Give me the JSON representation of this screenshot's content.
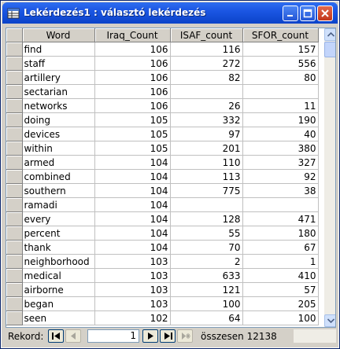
{
  "window": {
    "title": "Lekérdezés1 : választó lekérdezés"
  },
  "columns": [
    "Word",
    "Iraq_Count",
    "ISAF_count",
    "SFOR_count"
  ],
  "rows": [
    [
      "find",
      "106",
      "116",
      "157"
    ],
    [
      "staff",
      "106",
      "272",
      "556"
    ],
    [
      "artillery",
      "106",
      "82",
      "80"
    ],
    [
      "sectarian",
      "106",
      "",
      ""
    ],
    [
      "networks",
      "106",
      "26",
      "11"
    ],
    [
      "doing",
      "105",
      "332",
      "190"
    ],
    [
      "devices",
      "105",
      "97",
      "40"
    ],
    [
      "within",
      "105",
      "201",
      "380"
    ],
    [
      "armed",
      "104",
      "110",
      "327"
    ],
    [
      "combined",
      "104",
      "113",
      "92"
    ],
    [
      "southern",
      "104",
      "775",
      "38"
    ],
    [
      "ramadi",
      "104",
      "",
      ""
    ],
    [
      "every",
      "104",
      "128",
      "471"
    ],
    [
      "percent",
      "104",
      "55",
      "180"
    ],
    [
      "thank",
      "104",
      "70",
      "67"
    ],
    [
      "neighborhood",
      "103",
      "2",
      "1"
    ],
    [
      "medical",
      "103",
      "633",
      "410"
    ],
    [
      "airborne",
      "103",
      "121",
      "57"
    ],
    [
      "began",
      "103",
      "100",
      "205"
    ],
    [
      "seen",
      "102",
      "64",
      "100"
    ]
  ],
  "navigator": {
    "label": "Rekord:",
    "current_record": "1",
    "total_label": "összesen",
    "total_count": "12138"
  }
}
